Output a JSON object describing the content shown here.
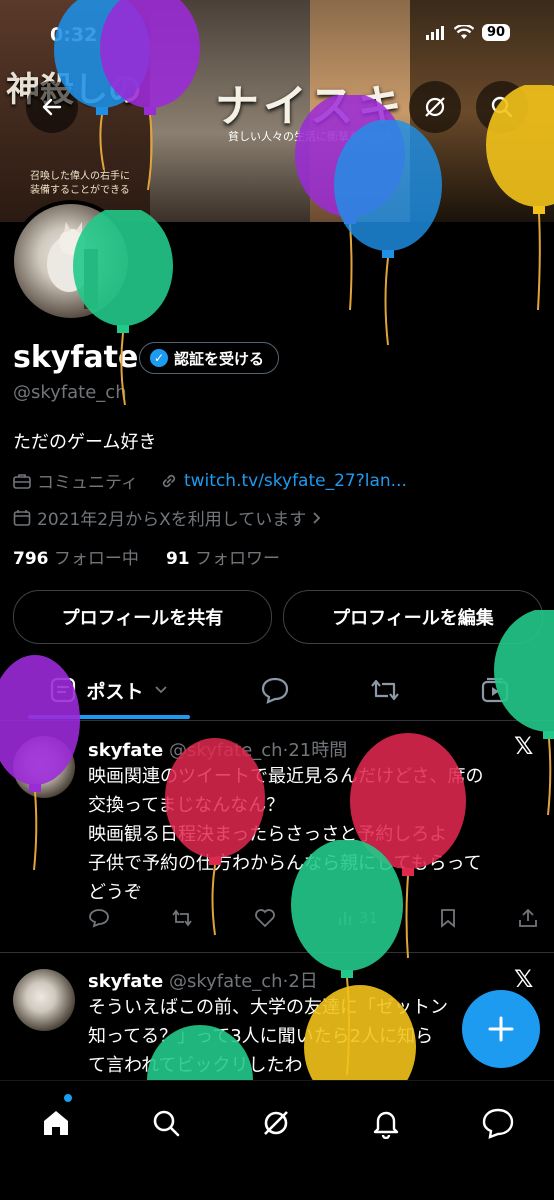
{
  "status_bar": {
    "time": "0:32",
    "battery": "90"
  },
  "banner": {
    "text_main": "ナイスキ",
    "text_left": "神殺しの",
    "caption": "貧しい人々の生活に衝撃を受ける",
    "caption_left": "召喚した偉人の右手に装備することができる"
  },
  "profile": {
    "display_name": "skyfate",
    "verify_label": "認証を受ける",
    "handle": "@skyfate_ch",
    "bio": "ただのゲーム好き",
    "category": "コミュニティ",
    "link": "twitch.tv/skyfate_27?lan...",
    "joined": "2021年2月からXを利用しています",
    "following_count": "796",
    "following_label": "フォロー中",
    "followers_count": "91",
    "followers_label": "フォロワー",
    "share_button": "プロフィールを共有",
    "edit_button": "プロフィールを編集"
  },
  "tabs": {
    "posts_label": "ポスト"
  },
  "posts": [
    {
      "name": "skyfate",
      "handle": "@skyfate_ch",
      "time": "21時間",
      "lines": [
        "映画関連のツイートで最近見るんだけどさ、席の",
        "交換ってまじなんなん？",
        "映画観る日程決まったらさっさと予約しろよ",
        "子供で予約の仕方わからんなら親にしてもらって",
        "どうぞ"
      ],
      "views": "31"
    },
    {
      "name": "skyfate",
      "handle": "@skyfate_ch",
      "time": "2日",
      "lines": [
        "そういえばこの前、大学の友達に「ゼットン",
        "知ってる？」って3人に聞いたら2人に知ら",
        "て言われてビックリしたわ"
      ]
    }
  ],
  "colors": {
    "accent": "#1d9bf0",
    "background": "#000000",
    "balloon_purple": "#9b2ad8",
    "balloon_green": "#22c98a",
    "balloon_blue": "#1e90e6",
    "balloon_red": "#e0284e",
    "balloon_yellow": "#f2c21b"
  }
}
